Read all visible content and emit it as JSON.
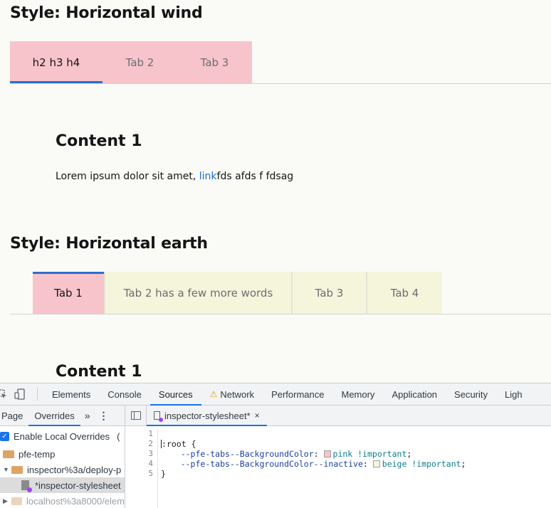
{
  "wind": {
    "heading": "Style: Horizontal wind",
    "tabs": [
      "h2 h3 h4",
      "Tab 2",
      "Tab 3"
    ],
    "content_title": "Content 1",
    "content_text_before": "Lorem ipsum dolor sit amet, ",
    "content_link": "link",
    "content_text_after": "fds afds f fdsag"
  },
  "earth": {
    "heading": "Style: Horizontal earth",
    "tabs": [
      "Tab 1",
      "Tab 2 has a few more words",
      "Tab 3",
      "Tab 4"
    ],
    "content_title": "Content 1"
  },
  "devtools": {
    "tabs": [
      "Elements",
      "Console",
      "Sources",
      "Network",
      "Performance",
      "Memory",
      "Application",
      "Security",
      "Ligh"
    ],
    "left_tabs": [
      "Page",
      "Overrides"
    ],
    "more_glyph": "»",
    "kebab_glyph": "⋮",
    "enable_overrides": "Enable Local Overrides",
    "enable_overrides_extra": "(",
    "tree": [
      "pfe-temp",
      "inspector%3a/deploy-p",
      "*inspector-stylesheet",
      "localhost%3a8000/elem"
    ],
    "editor_tab": "inspector-stylesheet*",
    "close_glyph": "×",
    "line_numbers": [
      "1",
      "2",
      "3",
      "4",
      "5"
    ],
    "code": {
      "l2": "root {",
      "l3_prop": "--pfe-tabs--BackgroundColor",
      "l3_val": "pink !important",
      "l4_prop": "--pfe-tabs--BackgroundColor--inactive",
      "l4_val": "beige !important",
      "l5": "}",
      "colon": ":",
      "semicolon": ";"
    },
    "swatch_colors": [
      "#f7c4cb",
      "#f5f5dc"
    ]
  }
}
